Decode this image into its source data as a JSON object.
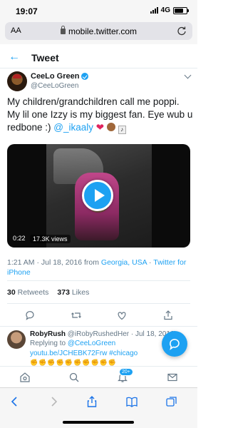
{
  "status_bar": {
    "time": "19:07",
    "network": "4G",
    "battery_level": 0.75
  },
  "browser": {
    "text_size_label": "AA",
    "url": "mobile.twitter.com"
  },
  "header": {
    "title": "Tweet"
  },
  "tweet": {
    "author_name": "CeeLo Green",
    "author_handle": "@CeeLoGreen",
    "text_main": "My children/grandchildren call me poppi. My lil one Izzy is my biggest fan. Eye wub u redbone :) ",
    "mention": "@_ikaaly",
    "emoji_heart": "❤",
    "video": {
      "duration": "0:22",
      "views": "17.3K views"
    },
    "time": "1:21 AM · Jul 18, 2016 from ",
    "location": "Georgia, USA",
    "source_sep": " · ",
    "source": "Twitter for iPhone",
    "retweets_count": "30",
    "retweets_label": "Retweets",
    "likes_count": "373",
    "likes_label": "Likes"
  },
  "reply": {
    "name": "RobyRush",
    "handle_date": "@iRobyRushedHer · Jul 18, 2016",
    "replying_prefix": "Replying to ",
    "replying_handle": "@CeeLoGreen",
    "link": "youtu.be/JCHEBK72Frw #chicago",
    "emojis": "✊✊✊✊✊✊✊✊✊✊"
  },
  "nav": {
    "badge": "20+"
  },
  "colors": {
    "accent": "#1da1f2",
    "text": "#14171a",
    "muted": "#657786",
    "heart": "#e0245e"
  }
}
